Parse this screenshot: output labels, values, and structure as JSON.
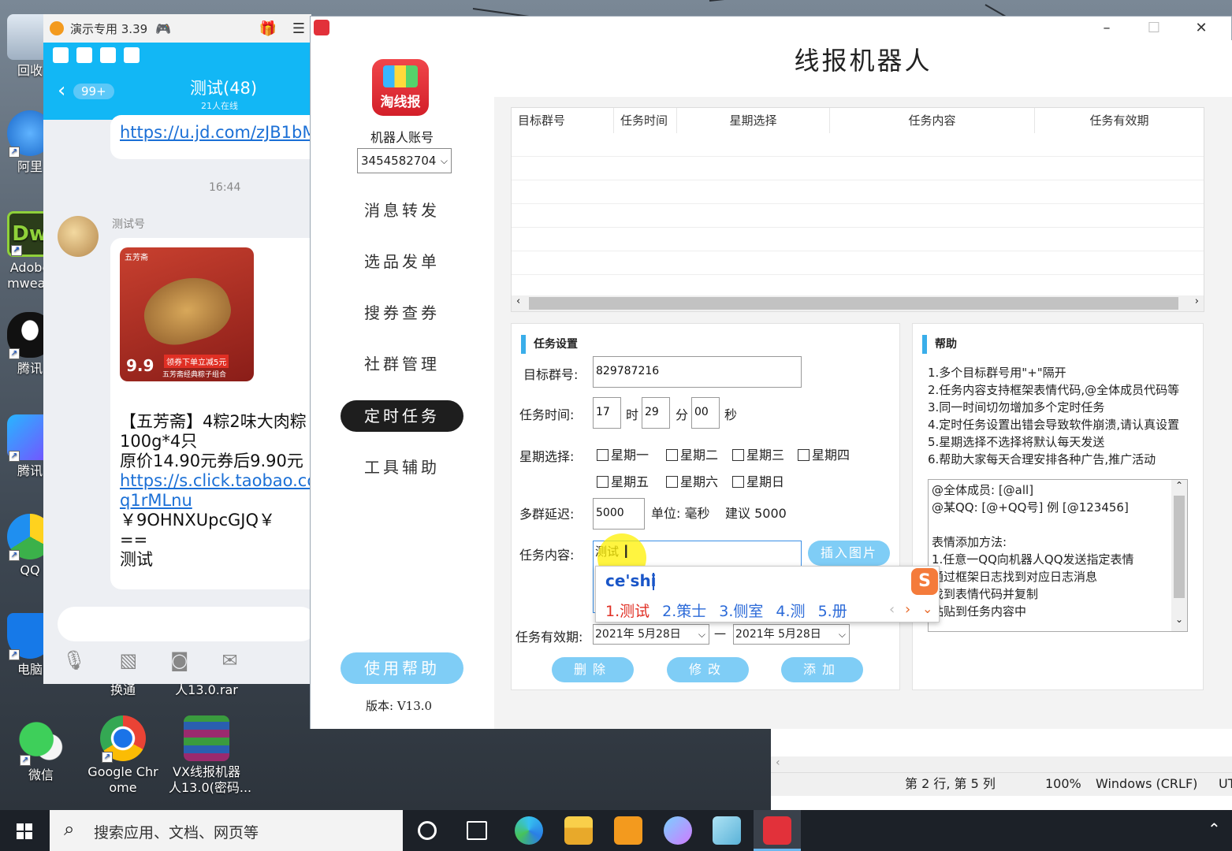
{
  "desktop": {
    "icons": [
      {
        "name": "recycle-bin",
        "label": "回收"
      },
      {
        "name": "aliwangwang",
        "label": "阿里"
      },
      {
        "name": "adobe-dreamweaver",
        "label": "Adobe\nmweav"
      },
      {
        "name": "tencent-qq",
        "label": "腾讯"
      },
      {
        "name": "tencent-video",
        "label": "腾讯"
      },
      {
        "name": "qq-browser",
        "label": "QQ"
      },
      {
        "name": "pc-manager",
        "label": "电脑"
      },
      {
        "name": "wechat",
        "label": "微信"
      },
      {
        "name": "google-chrome",
        "label": "Google Chr\nome"
      },
      {
        "name": "vx-robot-rar",
        "label": "VX线报机器\n人13.0(密码..."
      },
      {
        "name": "huantong",
        "label": "换通"
      },
      {
        "name": "rar-file",
        "label": "人13.0.rar"
      }
    ]
  },
  "qq_window": {
    "title": "演示专用 3.39",
    "back_badge": "99+",
    "chat_title": "测试(48)",
    "online": "21人在线",
    "link1": "https://u.jd.com/zJB1bM",
    "time": "16:44",
    "sender": "测试号",
    "product_brand": "五芳斋",
    "product_price": "9.9",
    "product_coupon": "领券下单立减5元",
    "product_sub": "五芳斋经典粽子组合",
    "msg_lines": [
      "【五芳斋】4粽2味大肉粽",
      "100g*4只",
      "原价14.90元券后9.90元"
    ],
    "link2a": "https://s.click.taobao.co",
    "link2b": "q1rMLnu",
    "code": "￥9OHNXUpcGJQ￥",
    "sep": "==",
    "test": "测试"
  },
  "app": {
    "title": "线报机器人",
    "logo_text": "淘线报",
    "account_label": "机器人账号",
    "account_value": "3454582704",
    "nav": [
      "消息转发",
      "选品发单",
      "搜券查券",
      "社群管理",
      "定时任务",
      "工具辅助"
    ],
    "active_nav": "定时任务",
    "help_button": "使用帮助",
    "version": "版本: V13.0",
    "table_headers": [
      "目标群号",
      "任务时间",
      "星期选择",
      "任务内容",
      "任务有效期"
    ],
    "task_section": "任务设置",
    "group_label": "目标群号:",
    "group_value": "829787216",
    "time_label": "任务时间:",
    "hour": "17",
    "hour_unit": "时",
    "minute": "29",
    "minute_unit": "分",
    "second": "00",
    "second_unit": "秒",
    "week_label": "星期选择:",
    "weekdays": [
      "星期一",
      "星期二",
      "星期三",
      "星期四",
      "星期五",
      "星期六",
      "星期日"
    ],
    "delay_label": "多群延迟:",
    "delay_value": "5000",
    "delay_unit": "单位: 毫秒",
    "delay_hint": "建议  5000",
    "content_label": "任务内容:",
    "content_value": "测试",
    "insert_image": "插入图片",
    "validity_label": "任务有效期:",
    "date_from": "2021年 5月28日",
    "date_to": "2021年 5月28日",
    "date_sep": "一",
    "btn_delete": "删除",
    "btn_edit": "修改",
    "btn_add": "添加",
    "help_section": "帮助",
    "help_lines": [
      "1.多个目标群号用\"+\"隔开",
      "2.任务内容支持框架表情代码,@全体成员代码等",
      "3.同一时间切勿增加多个定时任务",
      "4.定时任务设置出错会导致软件崩溃,请认真设置",
      "5.星期选择不选择将默认每天发送",
      "6.帮助大家每天合理安排各种广告,推广活动"
    ],
    "help_box_lines": [
      "@全体成员: [@all]",
      "@某QQ: [@+QQ号] 例 [@123456]",
      "",
      "表情添加方法:",
      "1.任意一QQ向机器人QQ发送指定表情",
      "通过框架日志找到对应日志消息",
      "找到表情代码并复制",
      "粘贴到任务内容中"
    ]
  },
  "ime": {
    "pinyin": "ce'shi",
    "candidates": [
      "1.测试",
      "2.策士",
      "3.侧室",
      "4.测",
      "5.册"
    ]
  },
  "notepad": {
    "position": "第 2 行, 第 5 列",
    "zoom": "100%",
    "eol": "Windows (CRLF)",
    "enc": "UT"
  },
  "taskbar": {
    "search_placeholder": "搜索应用、文档、网页等"
  }
}
